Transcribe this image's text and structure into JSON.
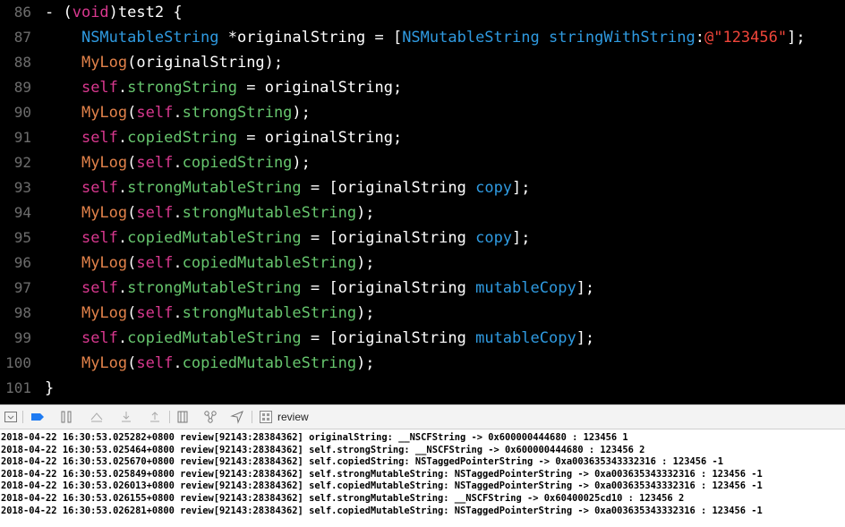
{
  "editor": {
    "lines": [
      {
        "num": "86",
        "tokens": [
          {
            "t": "- (",
            "c": "plain"
          },
          {
            "t": "void",
            "c": "kw"
          },
          {
            "t": ")test2 {",
            "c": "plain"
          }
        ]
      },
      {
        "num": "87",
        "tokens": [
          {
            "t": "    ",
            "c": "plain"
          },
          {
            "t": "NSMutableString",
            "c": "type"
          },
          {
            "t": " *originalString = [",
            "c": "plain"
          },
          {
            "t": "NSMutableString",
            "c": "type"
          },
          {
            "t": " ",
            "c": "plain"
          },
          {
            "t": "stringWithString",
            "c": "method"
          },
          {
            "t": ":",
            "c": "plain"
          },
          {
            "t": "@\"123456\"",
            "c": "str"
          },
          {
            "t": "];",
            "c": "plain"
          }
        ]
      },
      {
        "num": "88",
        "tokens": [
          {
            "t": "    ",
            "c": "plain"
          },
          {
            "t": "MyLog",
            "c": "macro"
          },
          {
            "t": "(originalString);",
            "c": "plain"
          }
        ]
      },
      {
        "num": "89",
        "tokens": [
          {
            "t": "    ",
            "c": "plain"
          },
          {
            "t": "self",
            "c": "kw"
          },
          {
            "t": ".",
            "c": "plain"
          },
          {
            "t": "strongString",
            "c": "prop"
          },
          {
            "t": " = originalString;",
            "c": "plain"
          }
        ]
      },
      {
        "num": "90",
        "tokens": [
          {
            "t": "    ",
            "c": "plain"
          },
          {
            "t": "MyLog",
            "c": "macro"
          },
          {
            "t": "(",
            "c": "plain"
          },
          {
            "t": "self",
            "c": "kw"
          },
          {
            "t": ".",
            "c": "plain"
          },
          {
            "t": "strongString",
            "c": "prop"
          },
          {
            "t": ");",
            "c": "plain"
          }
        ]
      },
      {
        "num": "91",
        "tokens": [
          {
            "t": "    ",
            "c": "plain"
          },
          {
            "t": "self",
            "c": "kw"
          },
          {
            "t": ".",
            "c": "plain"
          },
          {
            "t": "copiedString",
            "c": "prop"
          },
          {
            "t": " = originalString;",
            "c": "plain"
          }
        ]
      },
      {
        "num": "92",
        "tokens": [
          {
            "t": "    ",
            "c": "plain"
          },
          {
            "t": "MyLog",
            "c": "macro"
          },
          {
            "t": "(",
            "c": "plain"
          },
          {
            "t": "self",
            "c": "kw"
          },
          {
            "t": ".",
            "c": "plain"
          },
          {
            "t": "copiedString",
            "c": "prop"
          },
          {
            "t": ");",
            "c": "plain"
          }
        ]
      },
      {
        "num": "93",
        "tokens": [
          {
            "t": "    ",
            "c": "plain"
          },
          {
            "t": "self",
            "c": "kw"
          },
          {
            "t": ".",
            "c": "plain"
          },
          {
            "t": "strongMutableString",
            "c": "prop"
          },
          {
            "t": " = [originalString ",
            "c": "plain"
          },
          {
            "t": "copy",
            "c": "method"
          },
          {
            "t": "];",
            "c": "plain"
          }
        ]
      },
      {
        "num": "94",
        "tokens": [
          {
            "t": "    ",
            "c": "plain"
          },
          {
            "t": "MyLog",
            "c": "macro"
          },
          {
            "t": "(",
            "c": "plain"
          },
          {
            "t": "self",
            "c": "kw"
          },
          {
            "t": ".",
            "c": "plain"
          },
          {
            "t": "strongMutableString",
            "c": "prop"
          },
          {
            "t": ");",
            "c": "plain"
          }
        ]
      },
      {
        "num": "95",
        "tokens": [
          {
            "t": "    ",
            "c": "plain"
          },
          {
            "t": "self",
            "c": "kw"
          },
          {
            "t": ".",
            "c": "plain"
          },
          {
            "t": "copiedMutableString",
            "c": "prop"
          },
          {
            "t": " = [originalString ",
            "c": "plain"
          },
          {
            "t": "copy",
            "c": "method"
          },
          {
            "t": "];",
            "c": "plain"
          }
        ]
      },
      {
        "num": "96",
        "tokens": [
          {
            "t": "    ",
            "c": "plain"
          },
          {
            "t": "MyLog",
            "c": "macro"
          },
          {
            "t": "(",
            "c": "plain"
          },
          {
            "t": "self",
            "c": "kw"
          },
          {
            "t": ".",
            "c": "plain"
          },
          {
            "t": "copiedMutableString",
            "c": "prop"
          },
          {
            "t": ");",
            "c": "plain"
          }
        ]
      },
      {
        "num": "97",
        "tokens": [
          {
            "t": "    ",
            "c": "plain"
          },
          {
            "t": "self",
            "c": "kw"
          },
          {
            "t": ".",
            "c": "plain"
          },
          {
            "t": "strongMutableString",
            "c": "prop"
          },
          {
            "t": " = [originalString ",
            "c": "plain"
          },
          {
            "t": "mutableCopy",
            "c": "method"
          },
          {
            "t": "];",
            "c": "plain"
          }
        ]
      },
      {
        "num": "98",
        "tokens": [
          {
            "t": "    ",
            "c": "plain"
          },
          {
            "t": "MyLog",
            "c": "macro"
          },
          {
            "t": "(",
            "c": "plain"
          },
          {
            "t": "self",
            "c": "kw"
          },
          {
            "t": ".",
            "c": "plain"
          },
          {
            "t": "strongMutableString",
            "c": "prop"
          },
          {
            "t": ");",
            "c": "plain"
          }
        ]
      },
      {
        "num": "99",
        "tokens": [
          {
            "t": "    ",
            "c": "plain"
          },
          {
            "t": "self",
            "c": "kw"
          },
          {
            "t": ".",
            "c": "plain"
          },
          {
            "t": "copiedMutableString",
            "c": "prop"
          },
          {
            "t": " = [originalString ",
            "c": "plain"
          },
          {
            "t": "mutableCopy",
            "c": "method"
          },
          {
            "t": "];",
            "c": "plain"
          }
        ]
      },
      {
        "num": "100",
        "tokens": [
          {
            "t": "    ",
            "c": "plain"
          },
          {
            "t": "MyLog",
            "c": "macro"
          },
          {
            "t": "(",
            "c": "plain"
          },
          {
            "t": "self",
            "c": "kw"
          },
          {
            "t": ".",
            "c": "plain"
          },
          {
            "t": "copiedMutableString",
            "c": "prop"
          },
          {
            "t": ");",
            "c": "plain"
          }
        ]
      },
      {
        "num": "101",
        "tokens": [
          {
            "t": "}",
            "c": "plain"
          }
        ]
      }
    ]
  },
  "toolbar": {
    "icons": [
      "hide-debug-area-icon",
      "breakpoints-toggle-icon",
      "pause-icon",
      "step-over-icon",
      "step-into-icon",
      "step-out-icon",
      "view-hierarchy-icon",
      "memory-graph-icon",
      "simulate-location-icon",
      "target-process-icon"
    ],
    "process_label": "review"
  },
  "console": {
    "lines": [
      "2018-04-22 16:30:53.025282+0800 review[92143:28384362] originalString: __NSCFString -> 0x600000444680 : 123456 1",
      "2018-04-22 16:30:53.025464+0800 review[92143:28384362] self.strongString: __NSCFString -> 0x600000444680 : 123456 2",
      "2018-04-22 16:30:53.025670+0800 review[92143:28384362] self.copiedString: NSTaggedPointerString -> 0xa003635343332316 : 123456 -1",
      "2018-04-22 16:30:53.025849+0800 review[92143:28384362] self.strongMutableString: NSTaggedPointerString -> 0xa003635343332316 : 123456 -1",
      "2018-04-22 16:30:53.026013+0800 review[92143:28384362] self.copiedMutableString: NSTaggedPointerString -> 0xa003635343332316 : 123456 -1",
      "2018-04-22 16:30:53.026155+0800 review[92143:28384362] self.strongMutableString: __NSCFString -> 0x60400025cd10 : 123456 2",
      "2018-04-22 16:30:53.026281+0800 review[92143:28384362] self.copiedMutableString: NSTaggedPointerString -> 0xa003635343332316 : 123456 -1"
    ]
  }
}
